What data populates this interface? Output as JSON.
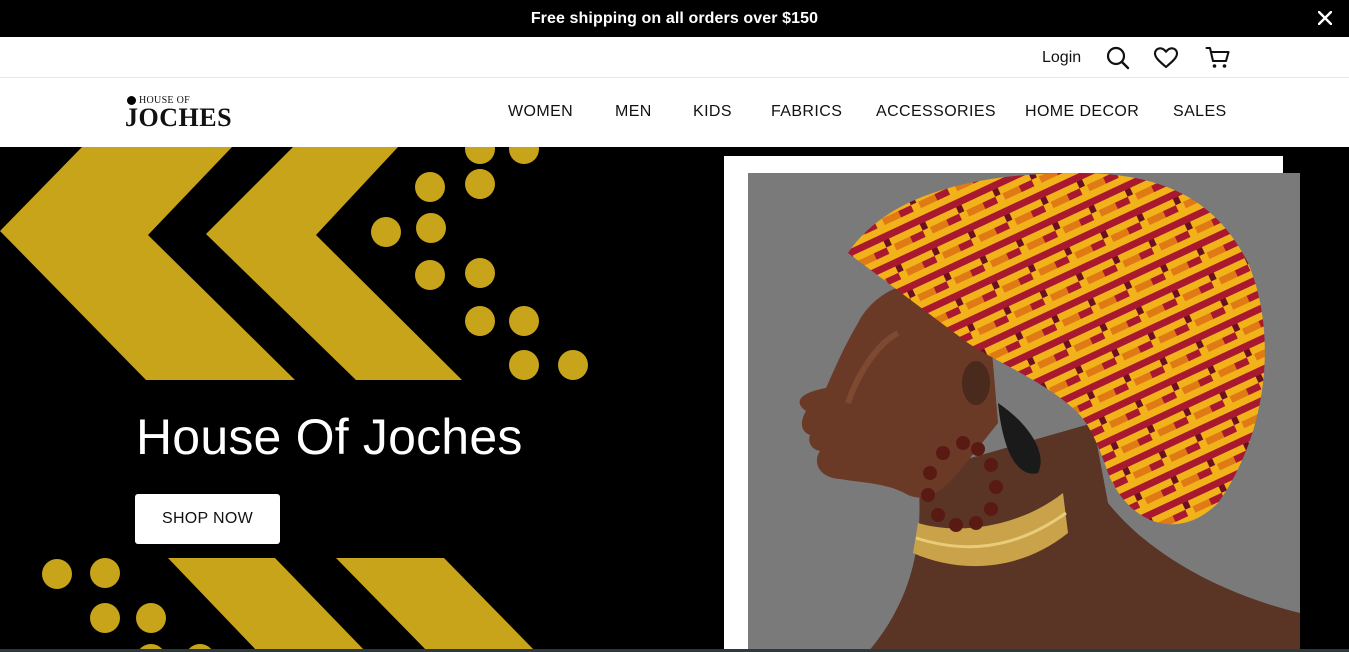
{
  "announcement": {
    "text": "Free shipping on all orders over $150",
    "close_icon": "close-icon"
  },
  "utility": {
    "login_label": "Login",
    "icons": [
      "search-icon",
      "heart-icon",
      "cart-icon"
    ]
  },
  "logo": {
    "small_text": "HOUSE OF",
    "big_text": "JOCHES"
  },
  "nav": {
    "items": [
      "WOMEN",
      "MEN",
      "KIDS",
      "FABRICS",
      "ACCESSORIES",
      "HOME DECOR",
      "SALES"
    ]
  },
  "hero": {
    "title": "House Of Joches",
    "button_label": "SHOP NOW"
  },
  "colors": {
    "accent_gold": "#c8a41a",
    "background": "#000000",
    "photo_background": "#7a7a7a"
  }
}
